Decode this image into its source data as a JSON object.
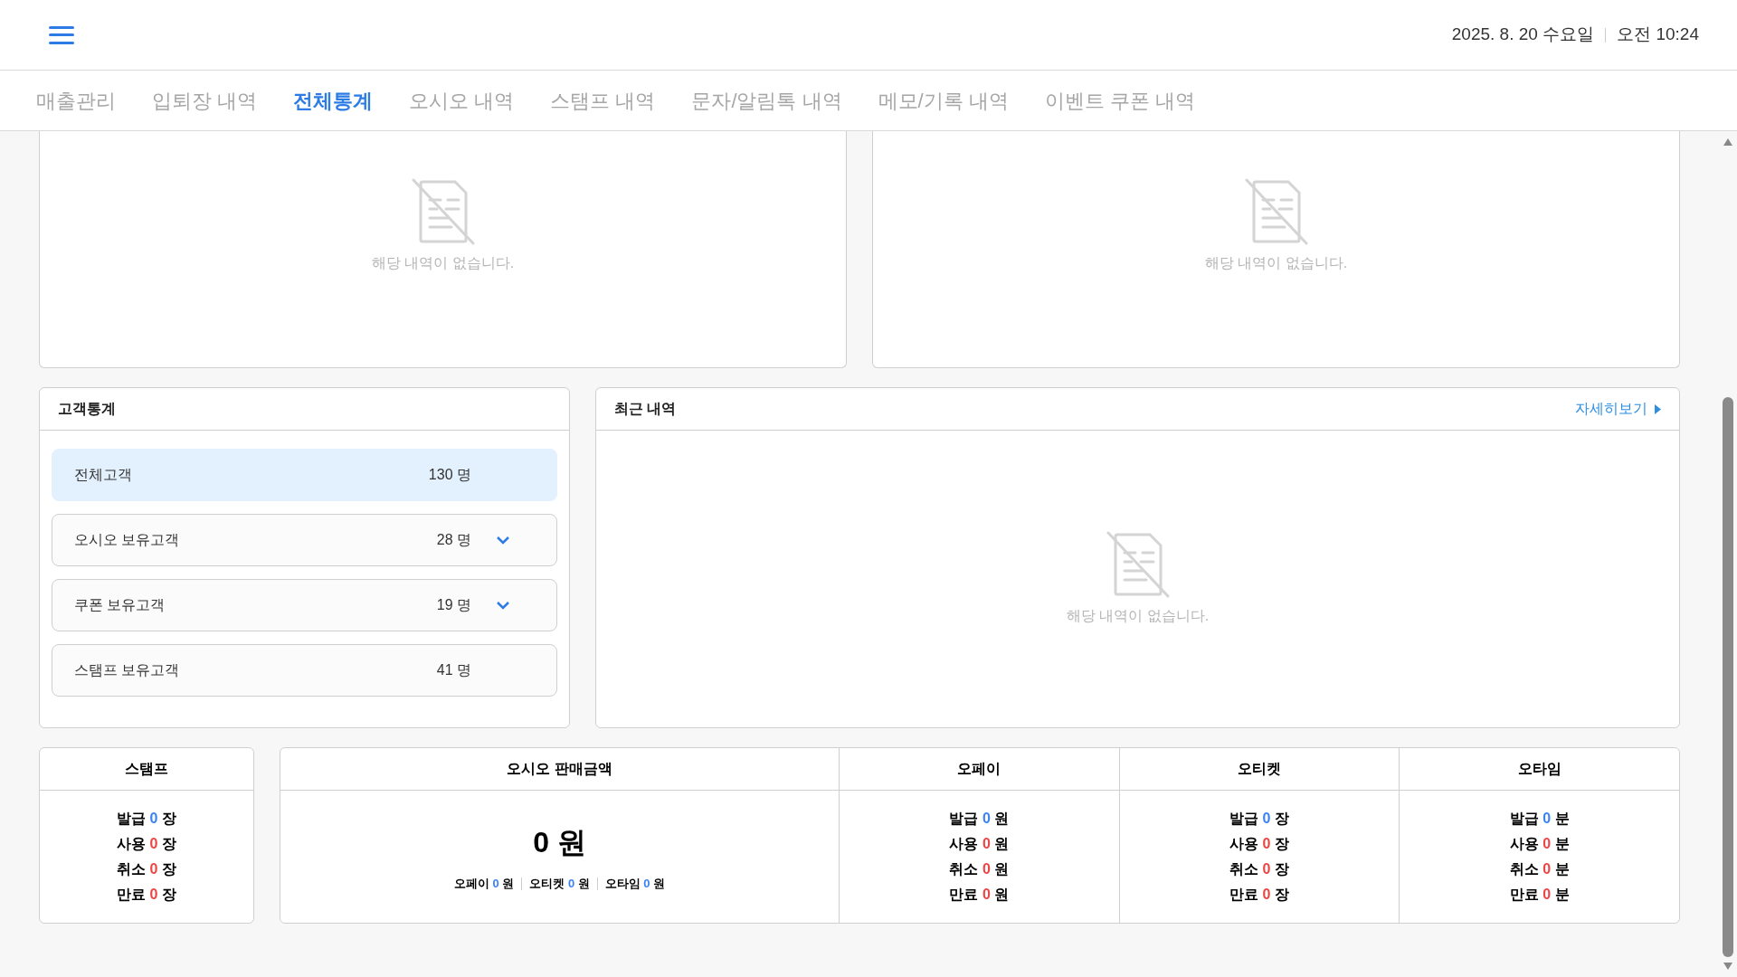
{
  "header": {
    "date": "2025. 8. 20 수요일",
    "time": "오전 10:24"
  },
  "tabs": [
    {
      "label": "매출관리",
      "selected": false
    },
    {
      "label": "입퇴장 내역",
      "selected": false
    },
    {
      "label": "전체통계",
      "selected": true
    },
    {
      "label": "오시오 내역",
      "selected": false
    },
    {
      "label": "스탬프 내역",
      "selected": false
    },
    {
      "label": "문자/알림톡 내역",
      "selected": false
    },
    {
      "label": "메모/기록 내역",
      "selected": false
    },
    {
      "label": "이벤트 쿠폰 내역",
      "selected": false
    }
  ],
  "top_panels": [
    {
      "empty_message": "해당 내역이 없습니다."
    },
    {
      "empty_message": "해당 내역이 없습니다."
    }
  ],
  "customer_stats": {
    "title": "고객통계",
    "items": [
      {
        "label": "전체고객",
        "count": "130 명",
        "selected": true,
        "kind": "plain"
      },
      {
        "label": "오시오 보유고객",
        "count": "28 명",
        "selected": false,
        "kind": "dropdown"
      },
      {
        "label": "쿠폰 보유고객",
        "count": "19 명",
        "selected": false,
        "kind": "dropdown"
      },
      {
        "label": "스탬프 보유고객",
        "count": "41 명",
        "selected": false,
        "kind": "plain"
      }
    ]
  },
  "recent": {
    "title": "최근 내역",
    "link": "자세히보기",
    "empty_message": "해당 내역이 없습니다."
  },
  "stamp": {
    "title": "스탬프",
    "lines": [
      {
        "label": "발급",
        "value": "0",
        "unit": "장",
        "color": "#3b82f6"
      },
      {
        "label": "사용",
        "value": "0",
        "unit": "장",
        "color": "#ef4444"
      },
      {
        "label": "취소",
        "value": "0",
        "unit": "장",
        "color": "#ef4444"
      },
      {
        "label": "만료",
        "value": "0",
        "unit": "장",
        "color": "#ef4444"
      }
    ]
  },
  "sales": {
    "title": "오시오 판매금액",
    "total": "0 원",
    "breakdown": [
      {
        "label": "오페이",
        "value": "0",
        "unit": "원"
      },
      {
        "label": "오티켓",
        "value": "0",
        "unit": "원"
      },
      {
        "label": "오타임",
        "value": "0",
        "unit": "원"
      }
    ]
  },
  "columns": [
    {
      "title": "오페이",
      "lines": [
        {
          "label": "발급",
          "value": "0",
          "unit": "원",
          "color": "#3b82f6"
        },
        {
          "label": "사용",
          "value": "0",
          "unit": "원",
          "color": "#ef4444"
        },
        {
          "label": "취소",
          "value": "0",
          "unit": "원",
          "color": "#ef4444"
        },
        {
          "label": "만료",
          "value": "0",
          "unit": "원",
          "color": "#ef4444"
        }
      ]
    },
    {
      "title": "오티켓",
      "lines": [
        {
          "label": "발급",
          "value": "0",
          "unit": "장",
          "color": "#3b82f6"
        },
        {
          "label": "사용",
          "value": "0",
          "unit": "장",
          "color": "#ef4444"
        },
        {
          "label": "취소",
          "value": "0",
          "unit": "장",
          "color": "#ef4444"
        },
        {
          "label": "만료",
          "value": "0",
          "unit": "장",
          "color": "#ef4444"
        }
      ]
    },
    {
      "title": "오타임",
      "lines": [
        {
          "label": "발급",
          "value": "0",
          "unit": "분",
          "color": "#3b82f6"
        },
        {
          "label": "사용",
          "value": "0",
          "unit": "분",
          "color": "#ef4444"
        },
        {
          "label": "취소",
          "value": "0",
          "unit": "분",
          "color": "#ef4444"
        },
        {
          "label": "만료",
          "value": "0",
          "unit": "분",
          "color": "#ef4444"
        }
      ]
    }
  ]
}
